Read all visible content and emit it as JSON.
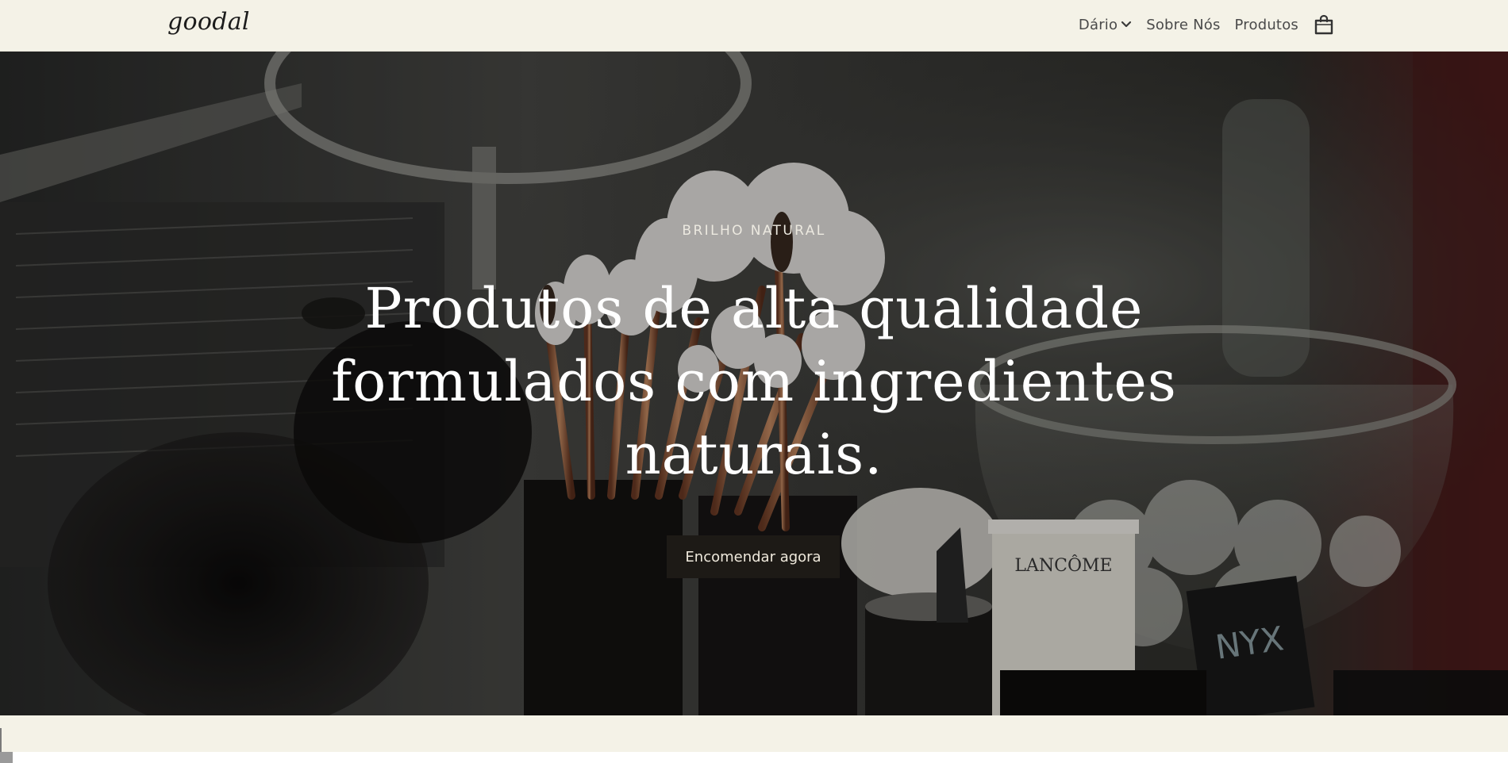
{
  "header": {
    "logo": "goodal",
    "nav": {
      "diario": "Dário",
      "sobre_nos": "Sobre Nós",
      "produtos": "Produtos"
    },
    "icons": [
      "chevron-down-icon",
      "shopping-bag-icon"
    ]
  },
  "hero": {
    "eyebrow": "BRILHO NATURAL",
    "headline_line1": "Produtos de alta qualidade",
    "headline_line2": "formulados com ingredientes",
    "headline_line3": "naturais.",
    "cta_label": "Encomendar agora",
    "product_labels": {
      "lancome": "LANCÔME",
      "nyx": "NYX"
    }
  },
  "colors": {
    "header_bg": "#f4f2e7",
    "cta_bg": "#1d1a16",
    "cta_text": "#efe9dc",
    "text_dark": "#1c1c1c"
  }
}
